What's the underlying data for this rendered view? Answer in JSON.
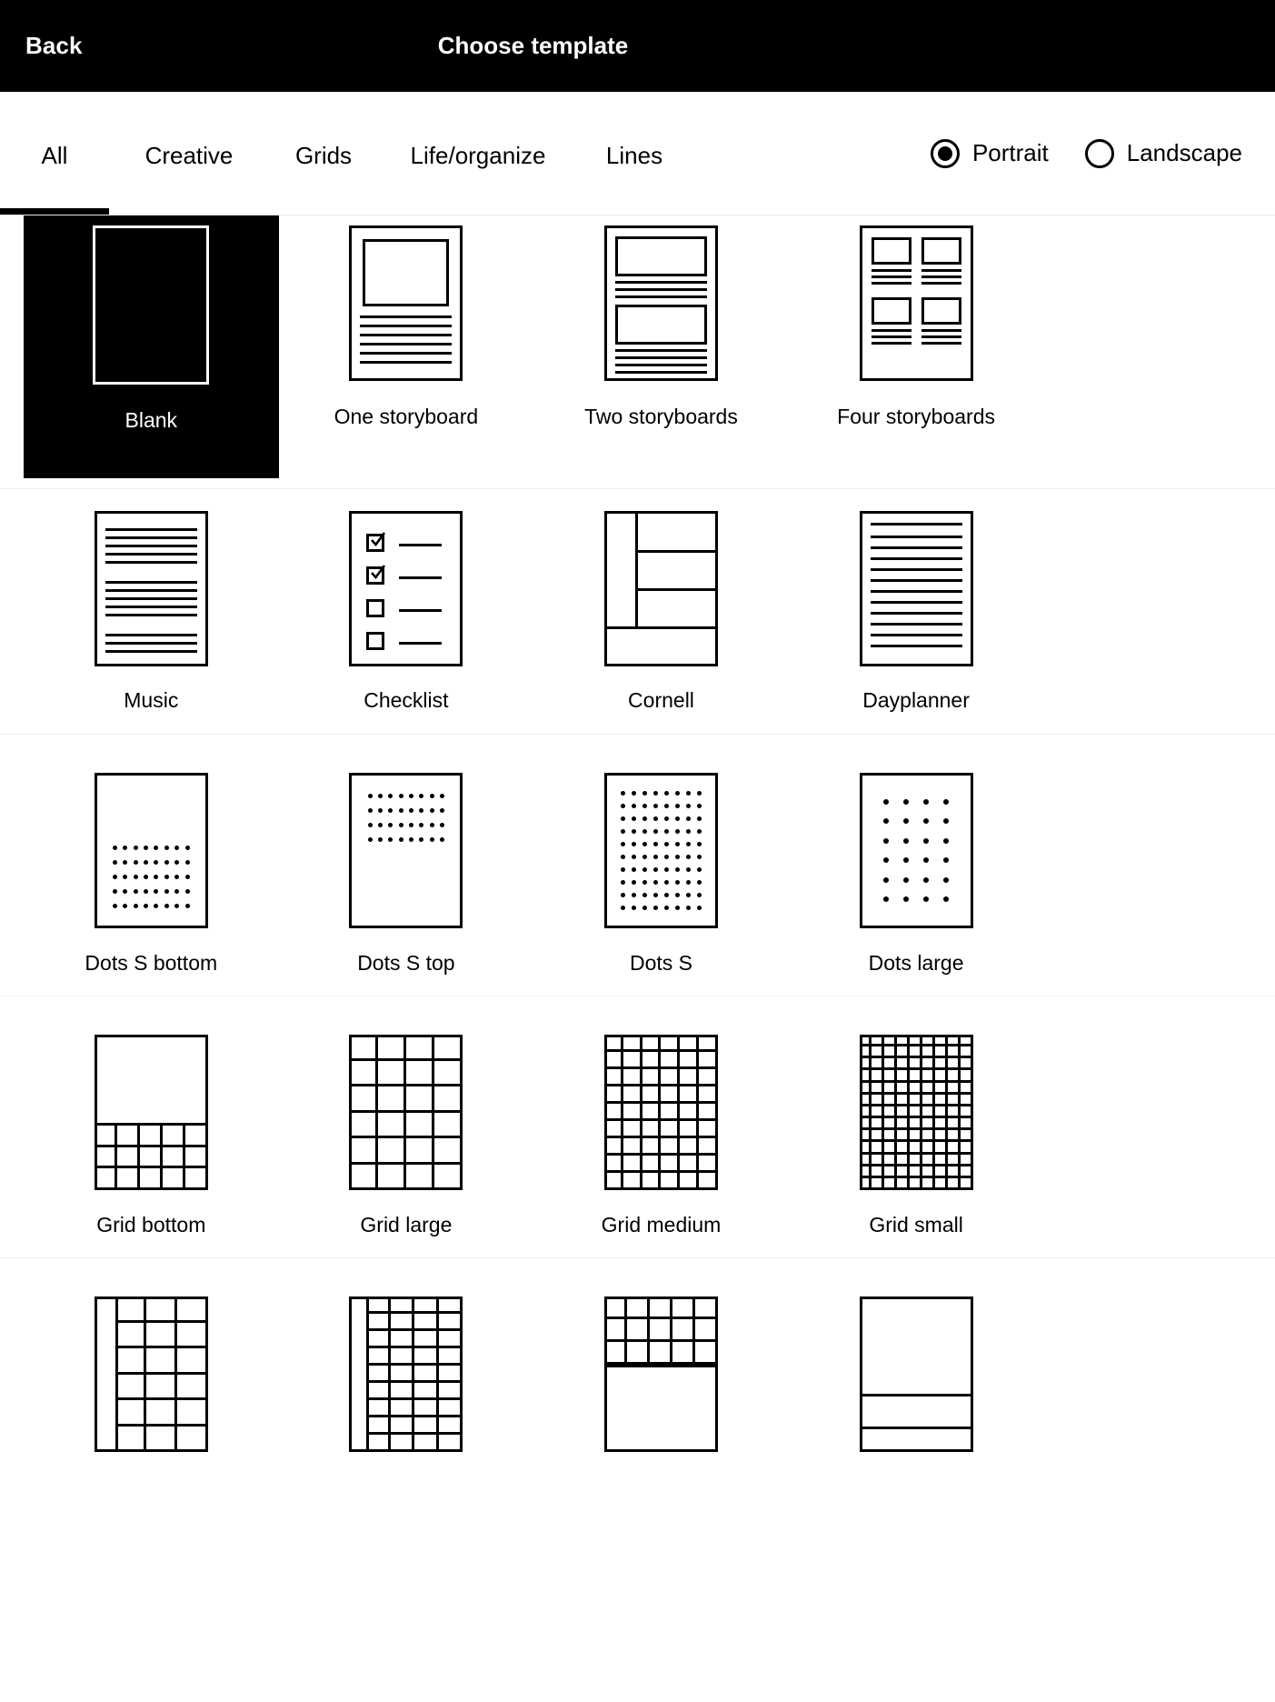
{
  "header": {
    "back_label": "Back",
    "title": "Choose template"
  },
  "tabs": [
    {
      "label": "All",
      "active": true
    },
    {
      "label": "Creative",
      "active": false
    },
    {
      "label": "Grids",
      "active": false
    },
    {
      "label": "Life/organize",
      "active": false
    },
    {
      "label": "Lines",
      "active": false
    }
  ],
  "orientation": {
    "options": [
      {
        "label": "Portrait",
        "selected": true
      },
      {
        "label": "Landscape",
        "selected": false
      }
    ]
  },
  "templates": {
    "row1": [
      {
        "label": "Blank",
        "selected": true
      },
      {
        "label": "One storyboard",
        "selected": false
      },
      {
        "label": "Two storyboards",
        "selected": false
      },
      {
        "label": "Four storyboards",
        "selected": false
      }
    ],
    "row2": [
      {
        "label": "Music",
        "selected": false
      },
      {
        "label": "Checklist",
        "selected": false
      },
      {
        "label": "Cornell",
        "selected": false
      },
      {
        "label": "Dayplanner",
        "selected": false
      }
    ],
    "row3": [
      {
        "label": "Dots S bottom",
        "selected": false
      },
      {
        "label": "Dots S top",
        "selected": false
      },
      {
        "label": "Dots S",
        "selected": false
      },
      {
        "label": "Dots large",
        "selected": false
      }
    ],
    "row4": [
      {
        "label": "Grid bottom",
        "selected": false
      },
      {
        "label": "Grid large",
        "selected": false
      },
      {
        "label": "Grid medium",
        "selected": false
      },
      {
        "label": "Grid small",
        "selected": false
      }
    ],
    "row5": [
      {
        "label": "",
        "selected": false
      },
      {
        "label": "",
        "selected": false
      },
      {
        "label": "",
        "selected": false
      },
      {
        "label": "",
        "selected": false
      }
    ]
  },
  "colors": {
    "accent": "#000000",
    "background": "#ffffff",
    "divider": "#f0f0f0",
    "selected_bg": "#000000",
    "selected_text": "#ffffff"
  }
}
